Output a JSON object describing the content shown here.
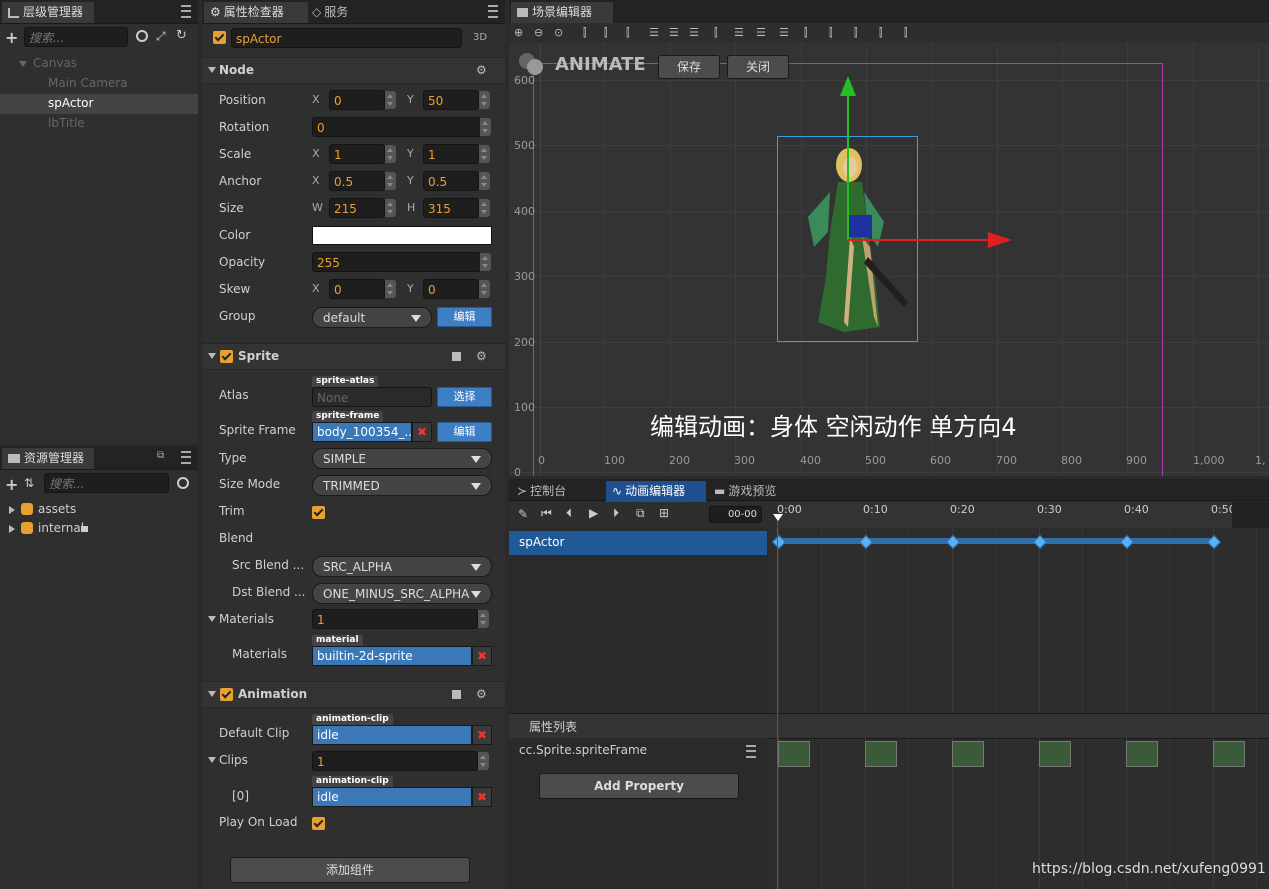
{
  "hierarchy": {
    "tab": "层级管理器",
    "search_placeholder": "搜索...",
    "nodes": [
      {
        "label": "Canvas"
      },
      {
        "label": "Main Camera"
      },
      {
        "label": "spActor"
      },
      {
        "label": "lbTitle"
      }
    ]
  },
  "assets": {
    "tab": "资源管理器",
    "search_placeholder": "搜索...",
    "items": [
      {
        "label": "assets"
      },
      {
        "label": "internal"
      }
    ]
  },
  "inspector": {
    "tabs": [
      "属性检查器",
      "服务"
    ],
    "node_name": "spActor",
    "mode_3d": "3D",
    "node_section": "Node",
    "position": {
      "label": "Position",
      "x": "0",
      "y": "50"
    },
    "rotation": {
      "label": "Rotation",
      "value": "0"
    },
    "scale": {
      "label": "Scale",
      "x": "1",
      "y": "1"
    },
    "anchor": {
      "label": "Anchor",
      "x": "0.5",
      "y": "0.5"
    },
    "size": {
      "label": "Size",
      "w": "215",
      "h": "315"
    },
    "color": {
      "label": "Color",
      "value": "#ffffff"
    },
    "opacity": {
      "label": "Opacity",
      "value": "255"
    },
    "skew": {
      "label": "Skew",
      "x": "0",
      "y": "0"
    },
    "group": {
      "label": "Group",
      "value": "default",
      "edit": "编辑"
    },
    "axis_x": "X",
    "axis_y": "Y",
    "axis_w": "W",
    "axis_h": "H",
    "sprite_section": "Sprite",
    "atlas": {
      "label": "Atlas",
      "tag": "sprite-atlas",
      "value": "None",
      "button": "选择"
    },
    "sprite_frame": {
      "label": "Sprite Frame",
      "tag": "sprite-frame",
      "value": "body_100354_...",
      "button": "编辑"
    },
    "type": {
      "label": "Type",
      "value": "SIMPLE"
    },
    "size_mode": {
      "label": "Size Mode",
      "value": "TRIMMED"
    },
    "trim": {
      "label": "Trim"
    },
    "blend": {
      "label": "Blend"
    },
    "src_blend": {
      "label": "Src Blend ...",
      "value": "SRC_ALPHA"
    },
    "dst_blend": {
      "label": "Dst Blend ...",
      "value": "ONE_MINUS_SRC_ALPHA"
    },
    "materials": {
      "label": "Materials",
      "count": "1",
      "tag": "material",
      "item_label": "Materials",
      "value": "builtin-2d-sprite"
    },
    "animation_section": "Animation",
    "default_clip": {
      "label": "Default Clip",
      "tag": "animation-clip",
      "value": "idle"
    },
    "clips": {
      "label": "Clips",
      "count": "1",
      "tag": "animation-clip",
      "item_label": "[0]",
      "value": "idle"
    },
    "play_on_load": {
      "label": "Play On Load"
    },
    "add_component": "添加组件"
  },
  "scene": {
    "tab": "场景编辑器",
    "animate_label": "ANIMATE",
    "save": "保存",
    "close": "关闭",
    "overlay_text": "编辑动画：身体 空闲动作 单方向4",
    "y_ticks": [
      "600",
      "500",
      "400",
      "300",
      "200",
      "100",
      "0"
    ],
    "x_ticks": [
      "0",
      "100",
      "200",
      "300",
      "400",
      "500",
      "600",
      "700",
      "800",
      "900",
      "1,000",
      "1,"
    ]
  },
  "timeline": {
    "tabs": [
      "控制台",
      "动画编辑器",
      "游戏预览"
    ],
    "time_display": "00-00",
    "time_ticks": [
      "0:00",
      "0:10",
      "0:20",
      "0:30",
      "0:40",
      "0:50"
    ],
    "node_row": "spActor",
    "props_header": "属性列表",
    "property": "cc.Sprite.spriteFrame",
    "add_property": "Add Property"
  },
  "watermark": "https://blog.csdn.net/xufeng0991",
  "colors": {
    "accent": "#e8a030",
    "selection": "#1f5a96",
    "asset_blue": "#3a78b8",
    "keyframe": "#5ab0f5"
  }
}
